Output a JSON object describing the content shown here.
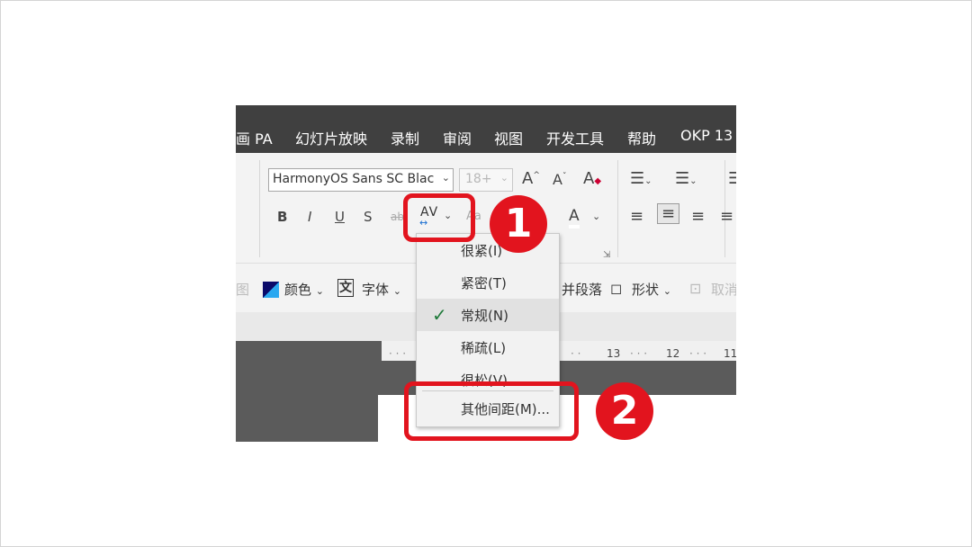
{
  "tabs": [
    "画 PA",
    "幻灯片放映",
    "录制",
    "审阅",
    "视图",
    "开发工具",
    "帮助",
    "OKP 13"
  ],
  "ribbon": {
    "font_name": "HarmonyOS Sans SC Blac",
    "font_size": "18+",
    "grow_font": "A",
    "shrink_font": "A",
    "bold": "B",
    "italic": "I",
    "underline": "U",
    "shadow": "S",
    "strikethrough": "ab",
    "spacing_label": "AV",
    "change_case": "Aa",
    "font_color": "A"
  },
  "toolbar2": {
    "color_label": "颜色",
    "font_label": "字体",
    "font_icon_char": "文",
    "para_label": "并段落",
    "shape_label": "形状",
    "cancel_label": "取消"
  },
  "ruler_ticks": [
    "13",
    "12",
    "11"
  ],
  "spacing_menu": {
    "items": [
      {
        "label": "很紧(I)",
        "selected": false
      },
      {
        "label": "紧密(T)",
        "selected": false
      },
      {
        "label": "常规(N)",
        "selected": true
      },
      {
        "label": "稀疏(L)",
        "selected": false
      },
      {
        "label": "很松(V)",
        "selected": false
      }
    ],
    "more": "其他间距(M)..."
  },
  "callouts": {
    "first": "1",
    "second": "2"
  },
  "colors": {
    "highlight": "#e2141e",
    "tabbar": "#404040",
    "ribbon": "#f3f3f3",
    "check": "#1f7a3a"
  }
}
